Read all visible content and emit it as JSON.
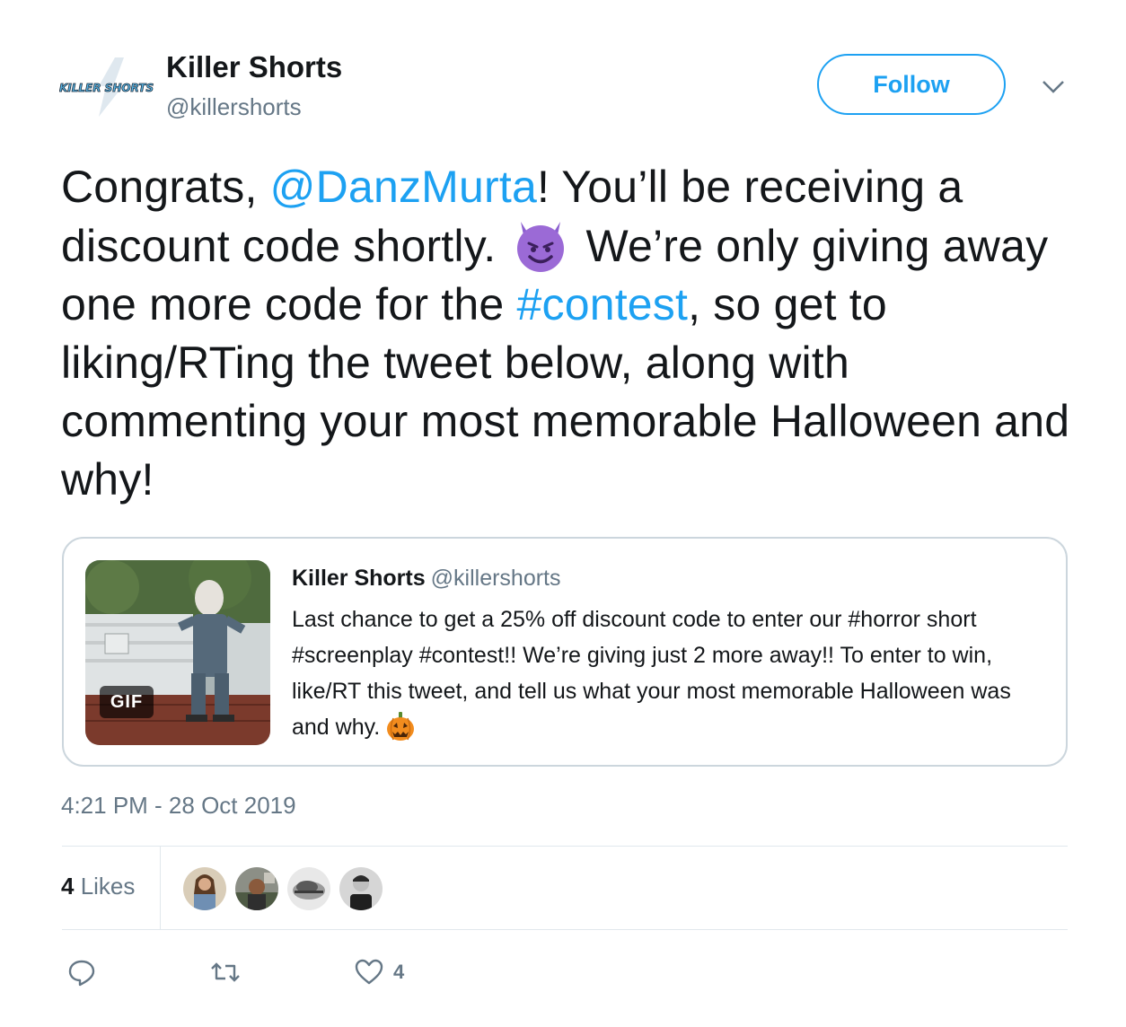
{
  "author": {
    "name": "Killer Shorts",
    "handle": "@killershorts",
    "logo_text": "KILLER SHORTS"
  },
  "follow_label": "Follow",
  "tweet": {
    "parts": {
      "p1": "Congrats, ",
      "mention": "@DanzMurta",
      "p2": "! You’ll be receiving a discount code shortly. ",
      "p3": " We’re only giving away one more code for the ",
      "hashtag": "#contest",
      "p4": ", so get to liking/RTing the tweet below, along with commenting your most memorable Halloween and why!"
    },
    "emoji": "smiling-face-with-horns"
  },
  "quoted": {
    "name": "Killer Shorts",
    "handle": "@killershorts",
    "text": "Last chance to get a 25% off discount code to enter our #horror short #screenplay #contest!! We’re giving just 2 more away!! To enter to win, like/RT this tweet, and tell us what your most memorable Halloween was and why.",
    "emoji": "jack-o-lantern",
    "gif_badge": "GIF"
  },
  "timestamp": "4:21 PM - 28 Oct 2019",
  "likes": {
    "count": "4",
    "label": " Likes"
  },
  "actions": {
    "like_count": "4"
  },
  "colors": {
    "link": "#1da1f2",
    "secondary_text": "#657786",
    "border": "#ccd6dd"
  }
}
